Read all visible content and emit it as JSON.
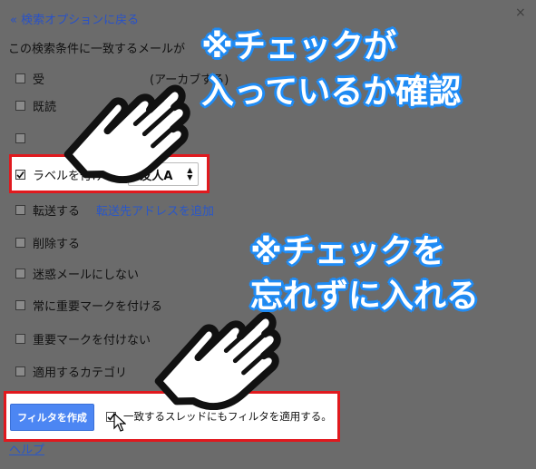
{
  "back_link": "« 検索オプションに戻る",
  "close_icon": "×",
  "heading": "この検索条件に一致するメールが",
  "options": [
    {
      "label": "受",
      "checked": false
    },
    {
      "label": "既読",
      "checked": false
    },
    {
      "label": "",
      "checked": false
    },
    {
      "label": "ラベルを付ける:",
      "checked": true
    },
    {
      "label": "転送する",
      "checked": false
    },
    {
      "label": "削除する",
      "checked": false
    },
    {
      "label": "迷惑メールにしない",
      "checked": false
    },
    {
      "label": "常に重要マークを付ける",
      "checked": false
    },
    {
      "label": "重要マークを付けない",
      "checked": false
    },
    {
      "label": "適用するカテゴリ",
      "checked": false
    }
  ],
  "archive_fragment": "(アーカブする)",
  "forward_link": "転送先アドレスを追加",
  "label_select": {
    "value": "友人A"
  },
  "create_filter_button": "フィルタを作成",
  "apply_checkbox": {
    "checked": true,
    "label": "一致するスレッドにもフィルタを適用する。"
  },
  "help_link": "ヘルプ",
  "callouts": {
    "top_line1": "※チェックが",
    "top_line2": "入っているか確認",
    "bottom_line1": "※チェックを",
    "bottom_line2": "忘れずに入れる"
  },
  "colors": {
    "highlight_border": "#e0191e",
    "callout_outline": "#1f8bf4",
    "button": "#4c86f3"
  }
}
